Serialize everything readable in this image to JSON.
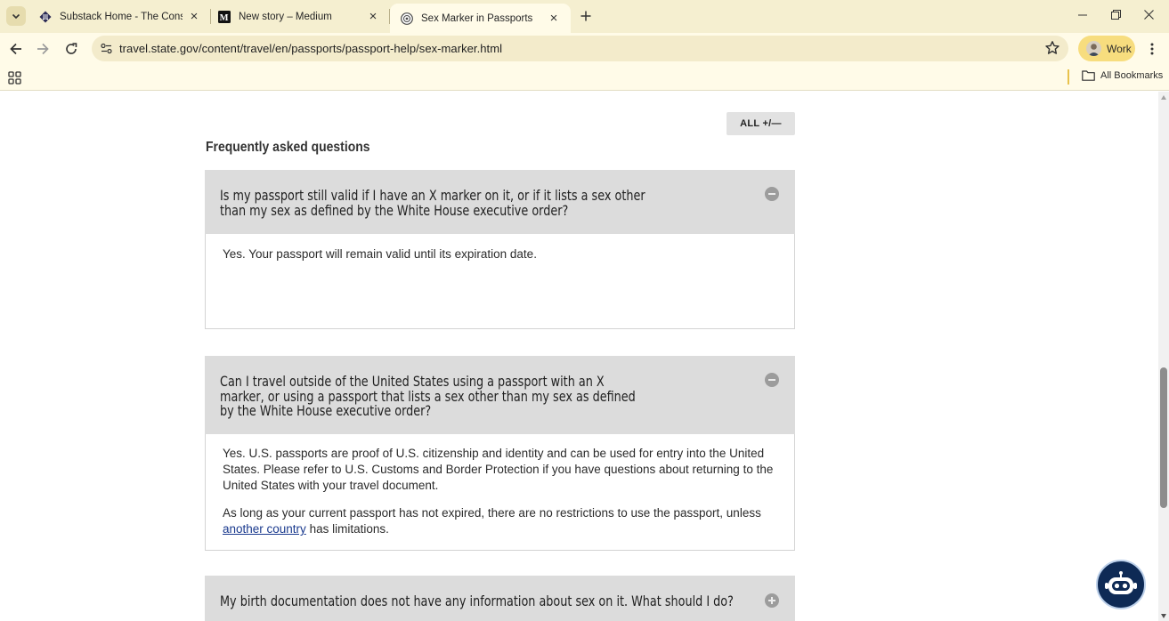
{
  "browser": {
    "tabs": [
      {
        "title": "Substack Home - The Conscientious",
        "favicon": "substack-icon",
        "active": false
      },
      {
        "title": "New story – Medium",
        "favicon": "medium-icon",
        "active": false
      },
      {
        "title": "Sex Marker in Passports",
        "favicon": "state-seal-icon",
        "active": true
      }
    ],
    "url": "travel.state.gov/content/travel/en/passports/passport-help/sex-marker.html",
    "profile_label": "Work",
    "all_bookmarks_label": "All Bookmarks"
  },
  "page": {
    "all_toggle_label": "ALL",
    "all_toggle_icon": "+/—",
    "faq_heading": "Frequently asked questions",
    "faqs": [
      {
        "question": "Is my passport still valid if I have an X marker on it, or if it lists a sex other than my sex as defined by the White House executive order?",
        "state": "expanded",
        "answer": [
          "Yes. Your passport will remain valid until its expiration date."
        ]
      },
      {
        "question": "Can I travel outside of the United States using a passport with an X marker, or using a passport that lists a sex other than my sex as defined by the White House executive order?",
        "state": "expanded",
        "answer": [
          "Yes. U.S. passports are proof of U.S. citizenship and identity and can be used for entry into the United States. Please refer to U.S. Customs and Border Protection if you have questions about returning to the United States with your travel document.",
          {
            "before": "As long as your current passport has not expired, there are no restrictions to use the passport, unless ",
            "link": "another country",
            "after": " has limitations."
          }
        ]
      },
      {
        "question": "My birth documentation does not have any information about sex on it. What should I do?",
        "state": "collapsed",
        "answer": []
      }
    ]
  },
  "colors": {
    "tabstrip_bg": "#f5efd0",
    "toolbar_bg": "#fffbe8",
    "profile_chip": "#f7dd7e",
    "faq_question_bg": "#dcdcdc",
    "link": "#1a3a8e",
    "chatbot_bg": "#0e2a55"
  }
}
